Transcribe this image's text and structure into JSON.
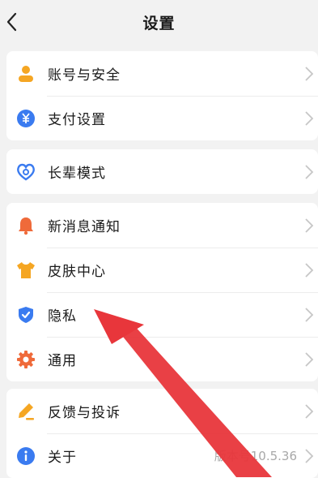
{
  "header": {
    "title": "设置"
  },
  "groups": [
    [
      {
        "label": "账号与安全",
        "icon": "person-icon"
      },
      {
        "label": "支付设置",
        "icon": "yuan-icon"
      }
    ],
    [
      {
        "label": "长辈模式",
        "icon": "heart-icon"
      }
    ],
    [
      {
        "label": "新消息通知",
        "icon": "bell-icon"
      },
      {
        "label": "皮肤中心",
        "icon": "shirt-icon"
      },
      {
        "label": "隐私",
        "icon": "shield-check-icon"
      },
      {
        "label": "通用",
        "icon": "gear-icon"
      }
    ],
    [
      {
        "label": "反馈与投诉",
        "icon": "pencil-icon"
      },
      {
        "label": "关于",
        "icon": "info-icon",
        "value": "版本号10.5.36"
      }
    ]
  ],
  "colors": {
    "accent_orange": "#f5a623",
    "accent_blue": "#3a7bf0",
    "alert_red": "#ef6a3a",
    "annotation_red": "#e8363b"
  }
}
